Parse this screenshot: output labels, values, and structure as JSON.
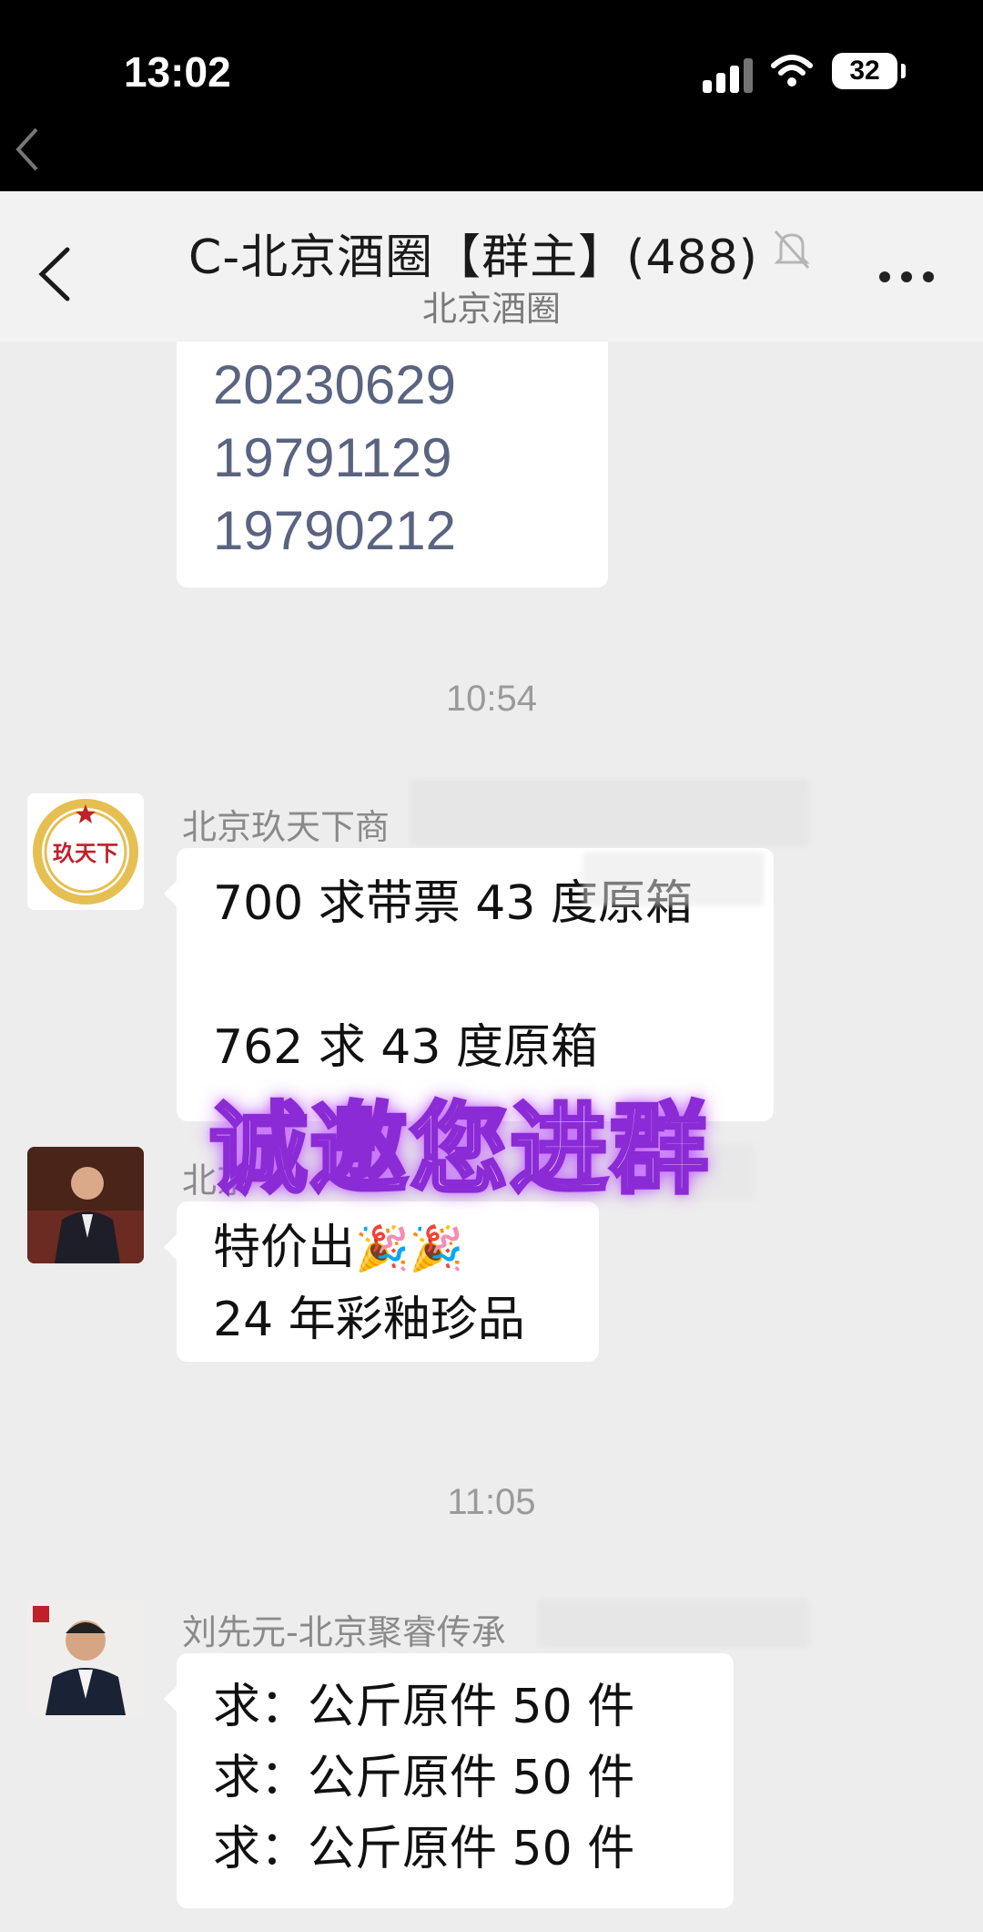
{
  "status_bar": {
    "time": "13:02",
    "battery": "32"
  },
  "nav": {
    "title": "C-北京酒圈【群主】(488)",
    "subtitle": "北京酒圈"
  },
  "messages": {
    "first_bubble_lines": [
      "20230629",
      "19791129",
      "19790212"
    ],
    "timestamp_1": "10:54",
    "msg1": {
      "sender": "北京玖天下商",
      "avatar_text": "玖天下",
      "line1": "700 求带票 43 度原箱",
      "line2": "762 求 43 度原箱"
    },
    "msg2": {
      "sender": "北京",
      "line1": "特价出",
      "line1_emoji": "🎉🎉",
      "line2": "24 年彩釉珍品"
    },
    "timestamp_2": "11:05",
    "msg3": {
      "sender": "刘先元-北京聚睿传承",
      "lines": [
        "求：公斤原件 50 件",
        "求：公斤原件 50 件",
        "求：公斤原件 50 件"
      ]
    }
  },
  "overlay_text": "诚邀您进群",
  "colors": {
    "status_bar_bg": "#000000",
    "chat_bg": "#ededed",
    "bubble_bg": "#ffffff",
    "overlay_stroke": "#8a2bd6"
  }
}
